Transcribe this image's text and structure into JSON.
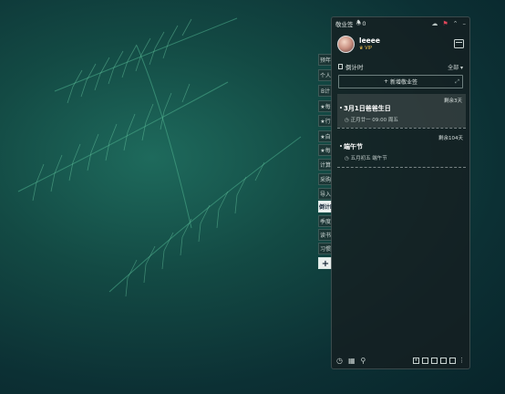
{
  "side_tabs": [
    {
      "label": "预年"
    },
    {
      "label": "个人"
    },
    {
      "label": "B计"
    },
    {
      "label": "★每"
    },
    {
      "label": "★行"
    },
    {
      "label": "★自"
    },
    {
      "label": "★每"
    },
    {
      "label": "计算"
    },
    {
      "label": "采购"
    },
    {
      "label": "导入"
    },
    {
      "label": "倒计时"
    },
    {
      "label": "季度"
    },
    {
      "label": "读书"
    },
    {
      "label": "习惯"
    }
  ],
  "add_tab_label": "+",
  "titlebar": {
    "app_name": "敬业签",
    "bell_count": "0"
  },
  "profile": {
    "username": "leeee",
    "vip_label": "VIP"
  },
  "section": {
    "title": "倒计时",
    "filter": "全部",
    "add_button": "新增敬业签"
  },
  "events": [
    {
      "title": "3月1日爸爸生日",
      "date": "正月廿一 09:00 周五",
      "remaining": "剩余3天"
    },
    {
      "title": "端午节",
      "date": "五月初五 端午节",
      "remaining": "剩余104天"
    }
  ],
  "colors": {
    "background": "#134a44",
    "panel": "#161e20",
    "vip": "#f3c04b",
    "accent_red": "#e0455a"
  },
  "icons": [
    "bell-icon",
    "cloud-icon",
    "pin-icon",
    "collapse-icon",
    "minimize-icon",
    "calendar-icon",
    "clock-icon",
    "search-icon",
    "grid-icon",
    "more-icon"
  ]
}
